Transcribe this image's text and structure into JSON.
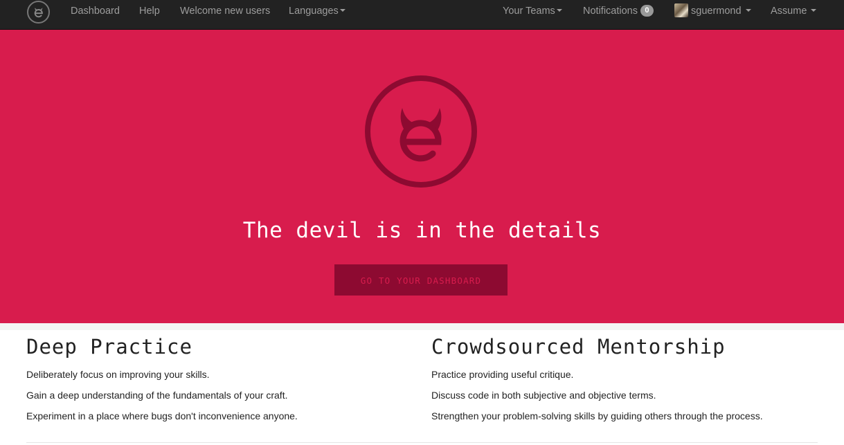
{
  "navbar": {
    "left_links": [
      {
        "label": "Dashboard"
      },
      {
        "label": "Help"
      },
      {
        "label": "Welcome new users"
      },
      {
        "label": "Languages"
      }
    ],
    "teams_label": "Your Teams",
    "notifications_label": "Notifications",
    "notifications_count": "0",
    "user_label": "sguermond",
    "assume_label": "Assume"
  },
  "hero": {
    "title": "The devil is in the details",
    "button_label": "GO TO YOUR DASHBOARD",
    "background_color": "#d81c4d",
    "accent_color": "#8d0a31"
  },
  "features": [
    {
      "title": "Deep Practice",
      "items": [
        "Deliberately focus on improving your skills.",
        "Gain a deep understanding of the fundamentals of your craft.",
        "Experiment in a place where bugs don't inconvenience anyone."
      ]
    },
    {
      "title": "Crowdsourced Mentorship",
      "items": [
        "Practice providing useful critique.",
        "Discuss code in both subjective and objective terms.",
        "Strengthen your problem-solving skills by guiding others through the process."
      ]
    }
  ],
  "icons": {
    "brand": "devil-e-logo-icon",
    "hero": "devil-e-logo-icon",
    "avatar": "user-avatar"
  }
}
